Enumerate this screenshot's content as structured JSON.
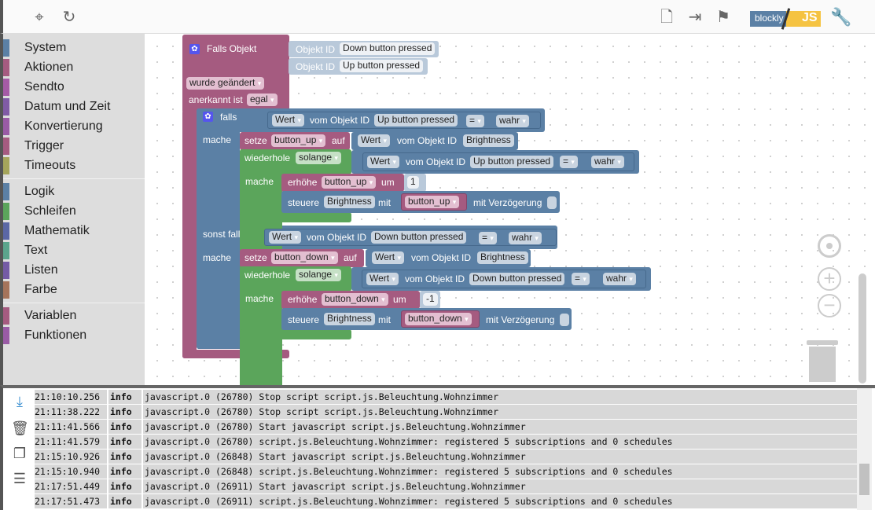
{
  "toolbar": {
    "left_icons": [
      "target-icon",
      "refresh-icon"
    ],
    "right_icons": [
      "export-icon",
      "import-icon",
      "checkered-flag-icon",
      "blockly-js-toggle",
      "wrench-icon"
    ],
    "blockly_label": "blockly",
    "js_label": "JS"
  },
  "sidebar": {
    "groups": [
      [
        {
          "label": "System",
          "color": "#5b80a5"
        },
        {
          "label": "Aktionen",
          "color": "#a55b80"
        },
        {
          "label": "Sendto",
          "color": "#a55ba5"
        },
        {
          "label": "Datum und Zeit",
          "color": "#805ba5"
        },
        {
          "label": "Konvertierung",
          "color": "#995ba5"
        },
        {
          "label": "Trigger",
          "color": "#a55b80"
        },
        {
          "label": "Timeouts",
          "color": "#a5a55b"
        }
      ],
      [
        {
          "label": "Logik",
          "color": "#5b80a5"
        },
        {
          "label": "Schleifen",
          "color": "#5ba55b"
        },
        {
          "label": "Mathematik",
          "color": "#5b67a5"
        },
        {
          "label": "Text",
          "color": "#5ba58c"
        },
        {
          "label": "Listen",
          "color": "#745ba5"
        },
        {
          "label": "Farbe",
          "color": "#a5745b"
        }
      ],
      [
        {
          "label": "Variablen",
          "color": "#a55b80"
        },
        {
          "label": "Funktionen",
          "color": "#995ba5"
        }
      ]
    ]
  },
  "blocks": {
    "trigger": {
      "title": "Falls Objekt",
      "objekt_id": "Objekt ID",
      "ids": [
        "Down button pressed",
        "Up button pressed"
      ],
      "changed": "wurde geändert",
      "ack_label": "anerkannt ist",
      "ack_value": "egal"
    },
    "if": {
      "falls": "falls",
      "mache": "mache",
      "sonst_falls": "sonst falls"
    },
    "branches": [
      {
        "cond": {
          "wert": "Wert",
          "vom": "vom Objekt ID",
          "id": "Up button pressed",
          "op": "=",
          "val": "wahr"
        },
        "setze": "setze",
        "var": "button_up",
        "auf": "auf",
        "src": {
          "wert": "Wert",
          "vom": "vom Objekt ID",
          "id": "Brightness"
        },
        "loop": {
          "label": "wiederhole",
          "mode": "solange",
          "mache": "mache",
          "cond": {
            "wert": "Wert",
            "vom": "vom Objekt ID",
            "id": "Up button pressed",
            "op": "=",
            "val": "wahr"
          }
        },
        "inc": {
          "label": "erhöhe",
          "var": "button_up",
          "um": "um",
          "val": "1"
        },
        "ctrl": {
          "label": "steuere",
          "target": "Brightness",
          "mit": "mit",
          "var": "button_up",
          "delay": "mit Verzögerung"
        }
      },
      {
        "cond": {
          "wert": "Wert",
          "vom": "vom Objekt ID",
          "id": "Down button pressed",
          "op": "=",
          "val": "wahr"
        },
        "setze": "setze",
        "var": "button_down",
        "auf": "auf",
        "src": {
          "wert": "Wert",
          "vom": "vom Objekt ID",
          "id": "Brightness"
        },
        "loop": {
          "label": "wiederhole",
          "mode": "solange",
          "mache": "mache",
          "cond": {
            "wert": "Wert",
            "vom": "vom Objekt ID",
            "id": "Down button pressed",
            "op": "=",
            "val": "wahr"
          }
        },
        "inc": {
          "label": "erhöhe",
          "var": "button_down",
          "um": "um",
          "val": "-1"
        },
        "ctrl": {
          "label": "steuere",
          "target": "Brightness",
          "mit": "mit",
          "var": "button_down",
          "delay": "mit Verzögerung"
        }
      }
    ]
  },
  "log": {
    "icons": [
      "scroll-down-icon",
      "clear-log-icon",
      "copy-icon",
      "toggle-list-icon"
    ],
    "rows": [
      {
        "time": "21:10:10.256",
        "level": "info",
        "msg": "javascript.0 (26780) Stop script script.js.Beleuchtung.Wohnzimmer"
      },
      {
        "time": "21:11:38.222",
        "level": "info",
        "msg": "javascript.0 (26780) Stop script script.js.Beleuchtung.Wohnzimmer"
      },
      {
        "time": "21:11:41.566",
        "level": "info",
        "msg": "javascript.0 (26780) Start javascript script.js.Beleuchtung.Wohnzimmer"
      },
      {
        "time": "21:11:41.579",
        "level": "info",
        "msg": "javascript.0 (26780) script.js.Beleuchtung.Wohnzimmer: registered 5 subscriptions and 0 schedules"
      },
      {
        "time": "21:15:10.926",
        "level": "info",
        "msg": "javascript.0 (26848) Start javascript script.js.Beleuchtung.Wohnzimmer"
      },
      {
        "time": "21:15:10.940",
        "level": "info",
        "msg": "javascript.0 (26848) script.js.Beleuchtung.Wohnzimmer: registered 5 subscriptions and 0 schedules"
      },
      {
        "time": "21:17:51.449",
        "level": "info",
        "msg": "javascript.0 (26911) Start javascript script.js.Beleuchtung.Wohnzimmer"
      },
      {
        "time": "21:17:51.473",
        "level": "info",
        "msg": "javascript.0 (26911) script.js.Beleuchtung.Wohnzimmer: registered 5 subscriptions and 0 schedules"
      }
    ]
  }
}
